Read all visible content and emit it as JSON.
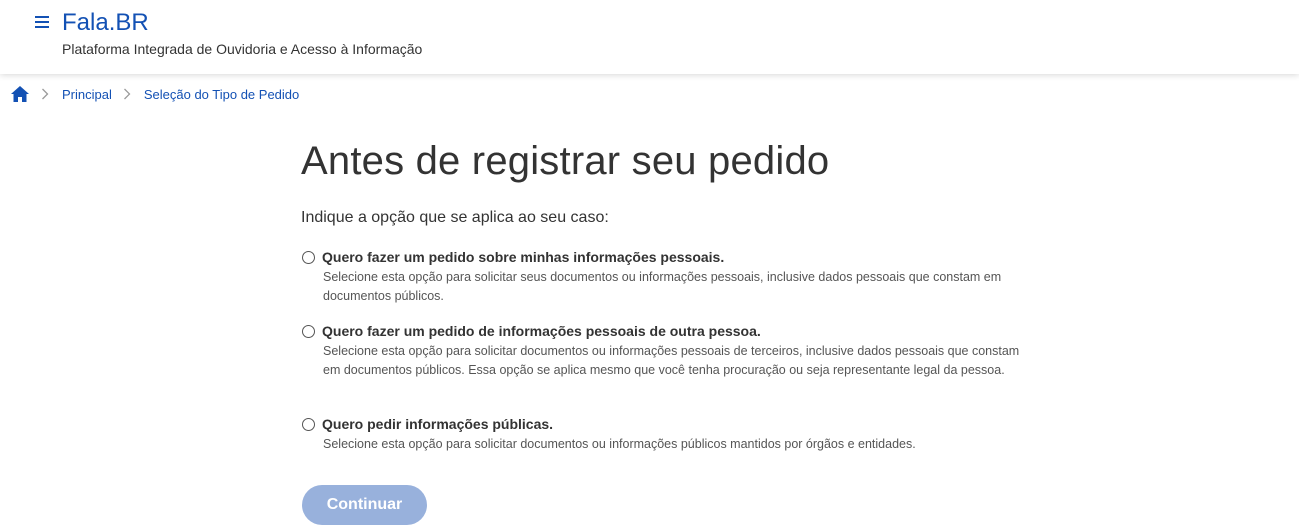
{
  "header": {
    "title": "Fala.BR",
    "subtitle": "Plataforma Integrada de Ouvidoria e Acesso à Informação",
    "menu_icon": "hamburger-menu-icon"
  },
  "breadcrumb": {
    "home_icon": "home-icon",
    "items": [
      {
        "label": "Principal"
      },
      {
        "label": "Seleção do Tipo de Pedido"
      }
    ]
  },
  "main": {
    "title": "Antes de registrar seu pedido",
    "prompt": "Indique a opção que se aplica ao seu caso:",
    "options": [
      {
        "label": "Quero fazer um pedido sobre minhas informações pessoais.",
        "description": "Selecione esta opção para solicitar seus documentos ou informações pessoais, inclusive dados pessoais que constam em documentos públicos.",
        "selected": false
      },
      {
        "label": "Quero fazer um pedido de informações pessoais de outra pessoa.",
        "description": "Selecione esta opção para solicitar documentos ou informações pessoais de terceiros, inclusive dados pessoais que constam em documentos públicos. Essa opção se aplica mesmo que você tenha procuração ou seja representante legal da pessoa.",
        "selected": false
      },
      {
        "label": "Quero pedir informações públicas.",
        "description": "Selecione esta opção para solicitar documentos ou informações públicos mantidos por órgãos e entidades.",
        "selected": false
      }
    ],
    "continue_label": "Continuar"
  },
  "colors": {
    "brand": "#1351b4",
    "button_disabled": "#98b1dc",
    "text": "#333333"
  }
}
